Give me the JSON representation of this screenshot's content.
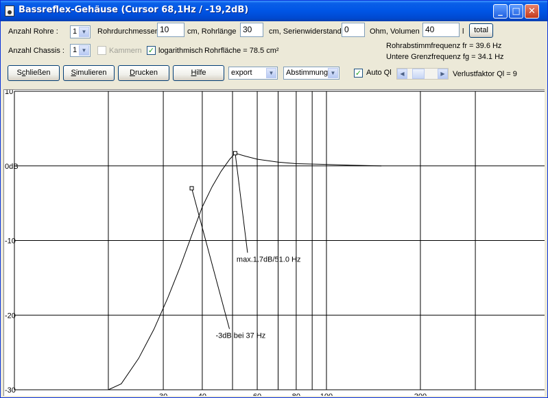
{
  "window": {
    "title": "Bassreflex-Gehäuse (Cursor 68,1Hz / -19,2dB)",
    "controls": {
      "minimize": "_",
      "maximize": "□",
      "close": "✕"
    }
  },
  "row1": {
    "anzahl_rohre_label": "Anzahl Rohre :",
    "anzahl_rohre_value": "1",
    "rohrdurchmesser_label": "Rohrdurchmesser",
    "rohrdurchmesser_value": "10",
    "rohrlaenge_label": "cm, Rohrlänge",
    "rohrlaenge_value": "30",
    "serienwiderstand_label": "cm, Serienwiderstand",
    "serienwiderstand_value": "0",
    "volumen_label": "Ohm, Volumen",
    "volumen_value": "40",
    "volumen_unit": "l",
    "total_button": "total"
  },
  "row2": {
    "anzahl_chassis_label": "Anzahl Chassis :",
    "anzahl_chassis_value": "1",
    "kammern_label": "Kammern",
    "kammern_checked": false,
    "log_label": "logarithmisch",
    "log_checked": true,
    "rohrflaeche": "Rohrfläche = 78.5 cm²",
    "abstimmfrequenz": "Rohrabstimmfrequenz fr = 39.6 Hz",
    "grenzfrequenz": "Untere Grenzfrequenz fg = 34.1 Hz"
  },
  "row3": {
    "schliessen_first": "S",
    "schliessen_u": "c",
    "schliessen_rest": "hließen",
    "simulieren_u": "S",
    "simulieren_rest": "imulieren",
    "drucken_u": "D",
    "drucken_rest": "rucken",
    "hilfe_u": "H",
    "hilfe_rest": "ilfe",
    "export_value": "export",
    "abstimmung_value": "Abstimmung",
    "auto_ql_label": "Auto Ql",
    "auto_ql_checked": true,
    "verlustfaktor": "Verlustfaktor Ql = 9",
    "verlustfaktor_slider": 0.25
  },
  "chart_data": {
    "type": "line",
    "x_scale": "log",
    "xlim": [
      10,
      500
    ],
    "ylim": [
      -30,
      10
    ],
    "grid": true,
    "y_ticks": [
      10,
      0,
      -10,
      -20,
      -30
    ],
    "y_tick_labels": [
      "10",
      "0dB",
      "-10",
      "-20",
      "-30"
    ],
    "x_grid": [
      20,
      30,
      40,
      50,
      60,
      70,
      80,
      90,
      100,
      200,
      300
    ],
    "x_tick_labels": [
      {
        "x": 30,
        "label": "30"
      },
      {
        "x": 40,
        "label": "40"
      },
      {
        "x": 60,
        "label": "60"
      },
      {
        "x": 80,
        "label": "80"
      },
      {
        "x": 100,
        "label": "100"
      },
      {
        "x": 200,
        "label": "200"
      }
    ],
    "series": [
      {
        "x": [
          10,
          20,
          22,
          25,
          28,
          31,
          34,
          37,
          40,
          43,
          46,
          49,
          51,
          55,
          60,
          70,
          80,
          100,
          120,
          150
        ],
        "y": [
          -30,
          -30,
          -29.2,
          -25.8,
          -21.9,
          -17.7,
          -13.5,
          -9.3,
          -5.5,
          -2.8,
          -0.7,
          0.9,
          1.7,
          1.3,
          0.9,
          0.5,
          0.3,
          0.2,
          0.1,
          0
        ]
      }
    ],
    "annotations": [
      {
        "text": "max.1.7dB/51.0 Hz",
        "x": 51.0,
        "y": 1.7
      },
      {
        "text": "-3dB bei  37 Hz",
        "x": 37,
        "y": -3
      }
    ]
  }
}
